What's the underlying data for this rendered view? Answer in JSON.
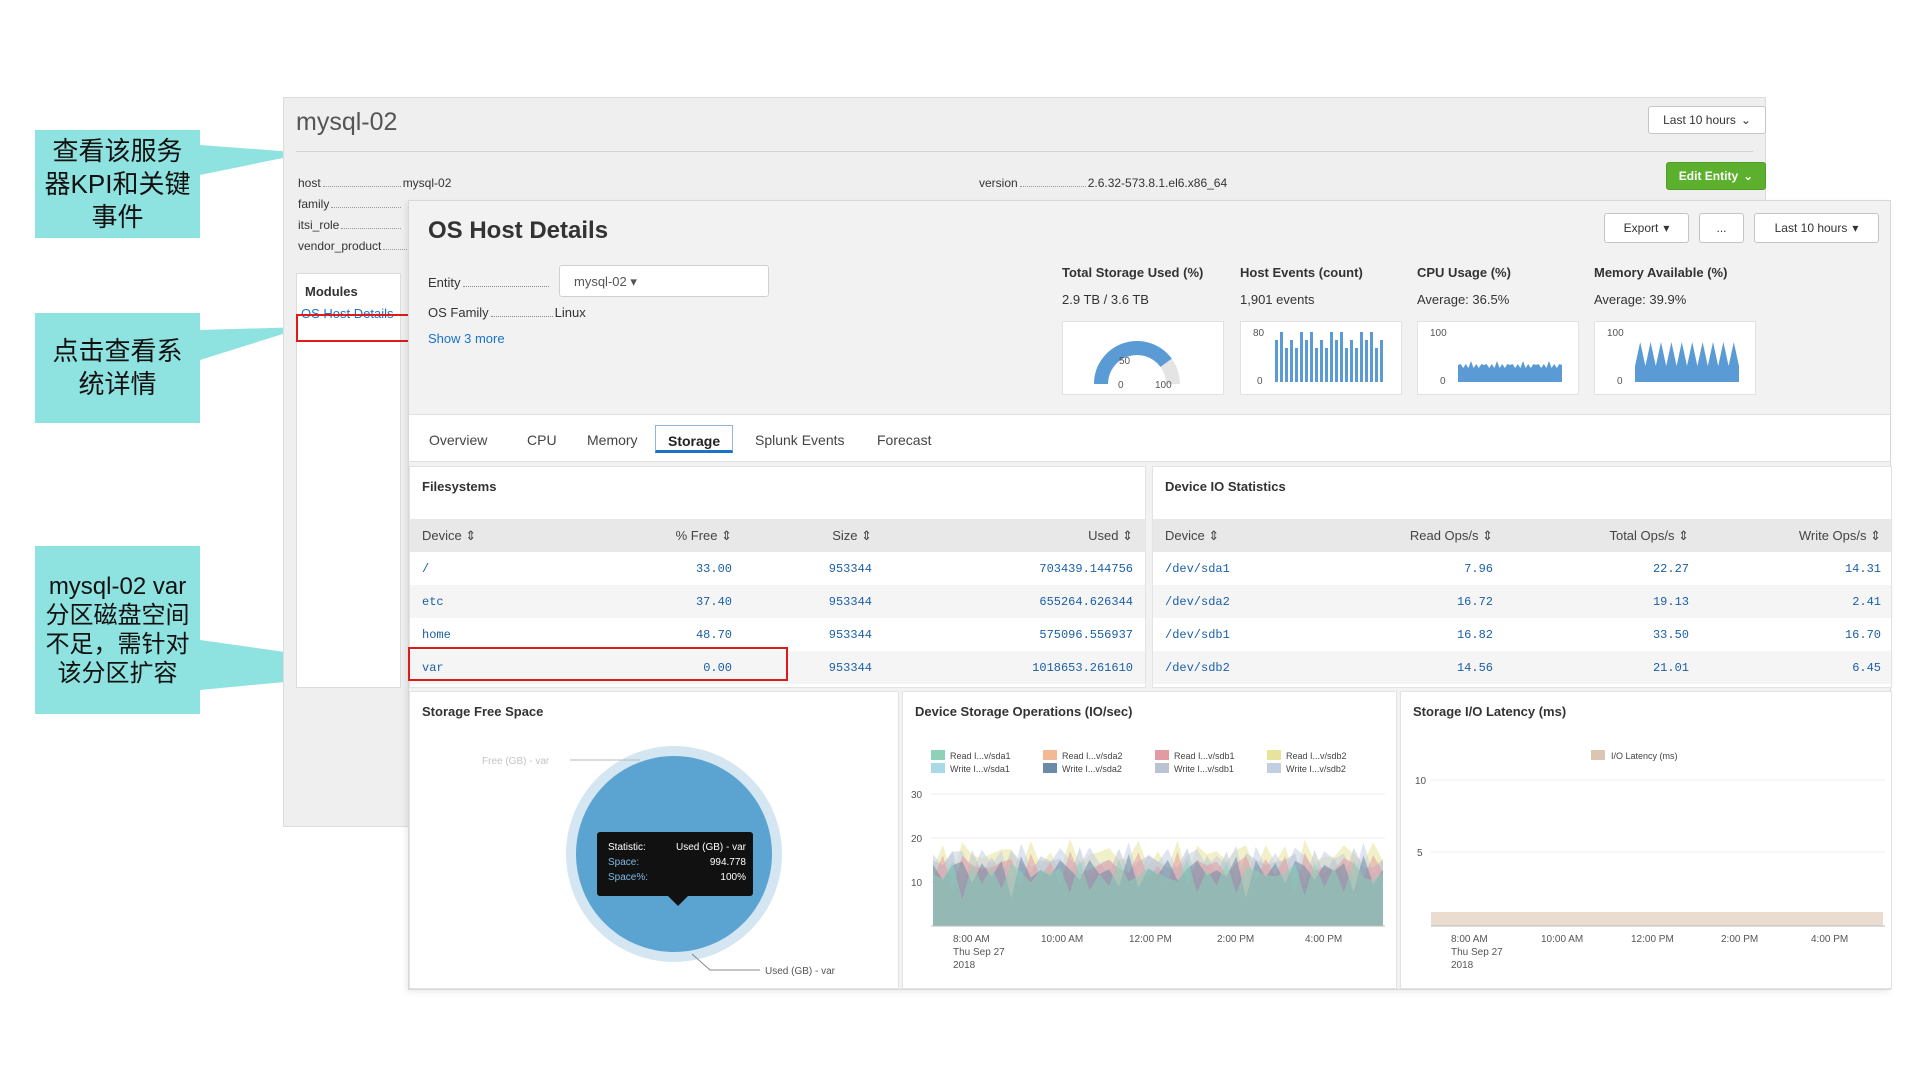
{
  "callouts": {
    "kpi": "查看该服务器KPI和关键事件",
    "details": "点击查看系统详情",
    "var_note": "mysql-02 var分区磁盘空间不足，需针对该分区扩容"
  },
  "entity_window": {
    "title": "mysql-02",
    "time_button": "Last 10 hours",
    "edit_button": "Edit Entity",
    "fields": [
      {
        "key": "host",
        "value": "mysql-02"
      },
      {
        "key": "family",
        "value": ""
      },
      {
        "key": "itsi_role",
        "value": ""
      },
      {
        "key": "vendor_product",
        "value": ""
      }
    ],
    "version": {
      "key": "version",
      "value": "2.6.32-573.8.1.el6.x86_64"
    },
    "modules_heading": "Modules",
    "modules_link": "OS Host Details"
  },
  "os_panel": {
    "title": "OS Host Details",
    "export_button": "Export",
    "more_button": "...",
    "time_button": "Last 10 hours",
    "entity_label": "Entity",
    "entity_value": "mysql-02",
    "os_family_label": "OS Family",
    "os_family_value": "Linux",
    "show_more": "Show 3 more",
    "metrics": [
      {
        "title": "Total Storage Used (%)",
        "value": "2.9 TB / 3.6 TB"
      },
      {
        "title": "Host Events (count)",
        "value": "1,901 events"
      },
      {
        "title": "CPU Usage (%)",
        "value": "Average: 36.5%"
      },
      {
        "title": "Memory Available (%)",
        "value": "Average: 39.9%"
      }
    ],
    "gauge": {
      "min": "0",
      "mid": "50",
      "max": "100",
      "fill_fraction": 0.8
    },
    "sparks": [
      {
        "top": "80",
        "bottom": "0"
      },
      {
        "top": "100",
        "bottom": "0"
      },
      {
        "top": "100",
        "bottom": "0"
      }
    ],
    "tabs": [
      "Overview",
      "CPU",
      "Memory",
      "Storage",
      "Splunk Events",
      "Forecast"
    ],
    "active_tab": "Storage"
  },
  "filesystems": {
    "title": "Filesystems",
    "columns": [
      "Device ⇕",
      "% Free ⇕",
      "Size ⇕",
      "Used ⇕"
    ],
    "rows": [
      [
        "/",
        "33.00",
        "953344",
        "703439.144756"
      ],
      [
        "etc",
        "37.40",
        "953344",
        "655264.626344"
      ],
      [
        "home",
        "48.70",
        "953344",
        "575096.556937"
      ],
      [
        "var",
        "0.00",
        "953344",
        "1018653.261610"
      ]
    ]
  },
  "device_io": {
    "title": "Device IO Statistics",
    "columns": [
      "Device ⇕",
      "Read Ops/s ⇕",
      "Total Ops/s ⇕",
      "Write Ops/s ⇕"
    ],
    "rows": [
      [
        "/dev/sda1",
        "7.96",
        "22.27",
        "14.31"
      ],
      [
        "/dev/sda2",
        "16.72",
        "19.13",
        "2.41"
      ],
      [
        "/dev/sdb1",
        "16.82",
        "33.50",
        "16.70"
      ],
      [
        "/dev/sdb2",
        "14.56",
        "21.01",
        "6.45"
      ]
    ]
  },
  "storage_free": {
    "title": "Storage Free Space",
    "label_free": "Free (GB) - var",
    "label_used": "Used (GB) - var",
    "tooltip": [
      {
        "k": "Statistic:",
        "v": "Used (GB) - var"
      },
      {
        "k": "Space:",
        "v": "994.778"
      },
      {
        "k": "Space%:",
        "v": "100%"
      }
    ]
  },
  "storage_ops": {
    "title": "Device Storage Operations (IO/sec)",
    "legend": [
      {
        "label": "Read I...v/sda1",
        "color": "#8cd1b8"
      },
      {
        "label": "Write I...v/sda1",
        "color": "#a9d8e6"
      },
      {
        "label": "Read I...v/sda2",
        "color": "#f3b894"
      },
      {
        "label": "Write I...v/sda2",
        "color": "#6d8aa8"
      },
      {
        "label": "Read I...v/sdb1",
        "color": "#e39aa1"
      },
      {
        "label": "Write I...v/sdb1",
        "color": "#b9c3d2"
      },
      {
        "label": "Read I...v/sdb2",
        "color": "#e6e49a"
      },
      {
        "label": "Write I...v/sdb2",
        "color": "#c2cfe3"
      }
    ],
    "y_ticks": [
      "30",
      "20",
      "10"
    ],
    "x_ticks": [
      "8:00 AM",
      "10:00 AM",
      "12:00 PM",
      "2:00 PM",
      "4:00 PM"
    ],
    "x_sub": [
      "Thu Sep 27",
      "2018"
    ]
  },
  "storage_latency": {
    "title": "Storage I/O Latency (ms)",
    "legend": "I/O Latency (ms)",
    "legend_color": "#dcc6b2",
    "y_ticks": [
      "10",
      "5"
    ],
    "x_ticks": [
      "8:00 AM",
      "10:00 AM",
      "12:00 PM",
      "2:00 PM",
      "4:00 PM"
    ],
    "x_sub": [
      "Thu Sep 27",
      "2018"
    ]
  }
}
